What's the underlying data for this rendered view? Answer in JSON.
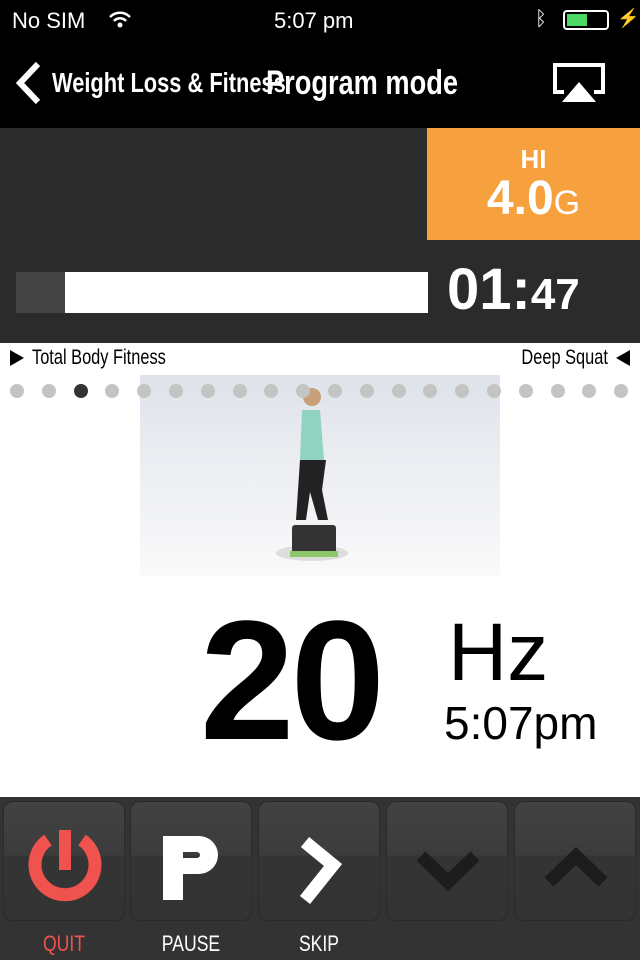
{
  "status_bar": {
    "carrier": "No SIM",
    "time": "5:07 pm",
    "icons": [
      "wifi-icon",
      "bluetooth-icon",
      "battery-icon",
      "charging-icon"
    ]
  },
  "nav": {
    "back_label": "Weight Loss & Fitness",
    "title": "Program mode",
    "airplay_icon": "airplay-icon"
  },
  "intensity": {
    "level": "HI",
    "value": "4.0",
    "unit": "G"
  },
  "timer": {
    "minutes": "01:",
    "seconds": "47",
    "progress_fraction": 0.12
  },
  "program": {
    "name": "Total Body Fitness",
    "exercise": "Deep Squat",
    "step_count": 20,
    "current_step": 3
  },
  "frequency": {
    "value": "20",
    "unit": "Hz",
    "clock": "5:07pm"
  },
  "controls": [
    {
      "label": "QUIT",
      "icon": "power-icon"
    },
    {
      "label": "PAUSE",
      "icon": "pause-p-icon"
    },
    {
      "label": "SKIP",
      "icon": "chevron-right-icon"
    },
    {
      "label": "",
      "icon": "chevron-down-icon"
    },
    {
      "label": "",
      "icon": "chevron-up-icon"
    }
  ],
  "colors": {
    "accent": "#f7a13e",
    "quit": "#f0534d",
    "panel": "#2b2b2b"
  }
}
